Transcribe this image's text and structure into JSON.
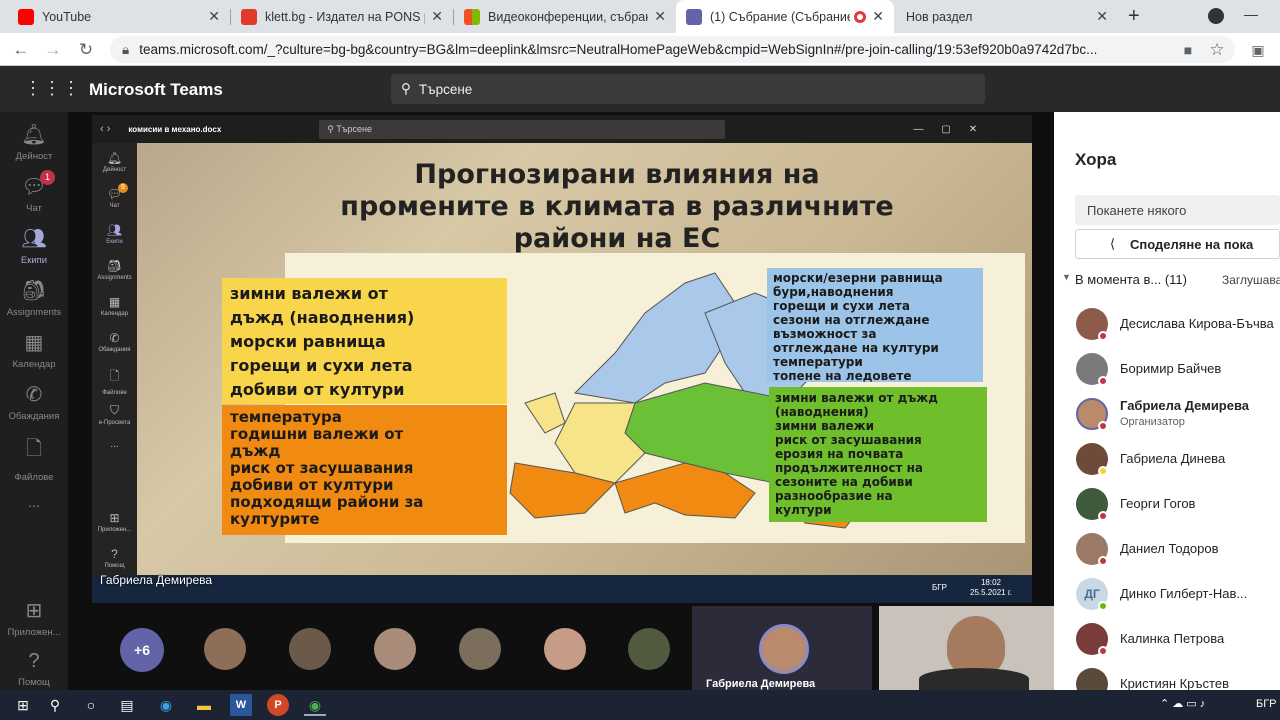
{
  "browser": {
    "tabs": [
      {
        "title": "YouTube",
        "color": "#ff0000"
      },
      {
        "title": "klett.bg - Издател на PONS p",
        "color": "#e23b2e"
      },
      {
        "title": "Видеоконференции, събран",
        "color": "#f25022"
      },
      {
        "title": "(1) Събрание (Събрание",
        "color": "#6264a7"
      },
      {
        "title": "Нов раздел",
        "color": ""
      }
    ],
    "url": "teams.microsoft.com/_?culture=bg-bg&country=BG&lm=deeplink&lmsrc=NeutralHomePageWeb&cmpid=WebSignIn#/pre-join-calling/19:53ef920b0a9742d7bc..."
  },
  "teams": {
    "app_title": "Microsoft Teams",
    "search_placeholder": "Търсене",
    "rail": [
      {
        "label": "Дейност",
        "icon": "bell-icon"
      },
      {
        "label": "Чат",
        "icon": "chat-icon",
        "badge": "1"
      },
      {
        "label": "Екипи",
        "icon": "teams-icon"
      },
      {
        "label": "Assignments",
        "icon": "assignments-icon"
      },
      {
        "label": "Календар",
        "icon": "calendar-icon"
      },
      {
        "label": "Обаждания",
        "icon": "phone-icon"
      },
      {
        "label": "Файлове",
        "icon": "file-icon"
      },
      {
        "label": "...",
        "icon": "more-icon"
      },
      {
        "label": "Приложен...",
        "icon": "apps-icon"
      },
      {
        "label": "Помощ",
        "icon": "help-icon"
      }
    ]
  },
  "shared": {
    "doc_title": "комисии в механо.docx",
    "search_placeholder": "Търсене",
    "inner_rail": [
      "Дейност",
      "Чат",
      "Екипи",
      "Assignments",
      "Календар",
      "Обаждания",
      "Файлове",
      "е-Просвета",
      "...",
      "Приложен...",
      "Помощ"
    ],
    "inner_chat_badge": "9",
    "presenter": "Габриела Демирева",
    "clock_time": "18:02",
    "clock_date": "25.5.2021 г.",
    "lang": "БГР"
  },
  "slide": {
    "title_line1": "Прогнозирани влияния на",
    "title_line2": "промените в климата в различните",
    "title_line3": "райони на ЕС",
    "yellow_box": [
      "зимни валежи от",
      "дъжд (наводнения)",
      "морски равнища",
      "горещи и сухи лета",
      "добиви от култури"
    ],
    "orange_box": [
      "температура",
      "годишни валежи от",
      "дъжд",
      "риск от засушавания",
      "добиви от култури",
      "подходящи райони за",
      "културите"
    ],
    "blue_box": [
      "морски/езерни равнища",
      "бури,наводнения",
      "горещи и сухи лета",
      "сезони на отглеждане",
      "възможност за",
      "отглеждане на култури",
      "температури",
      "топене на ледовете"
    ],
    "green_box": [
      "зимни валежи от дъжд",
      "(наводнения)",
      "зимни валежи",
      "риск от засушавания",
      "ерозия на почвата",
      "продължителност на",
      "сезоните на добиви",
      "разнообразие на",
      "култури"
    ]
  },
  "gallery": {
    "more_count": "+6",
    "active_name": "Габриела Демирева"
  },
  "people": {
    "title": "Хора",
    "invite_placeholder": "Поканете някого",
    "share_label": "Споделяне на пока",
    "section_label": "В момента в...",
    "section_count": "(11)",
    "mute_label": "Заглушава",
    "list": [
      {
        "name": "Десислава Кирова-Бъчва",
        "status_color": "#c4314b",
        "avatar_color": "#8e5b4a"
      },
      {
        "name": "Боримир Байчев",
        "status_color": "#c4314b",
        "avatar_color": "#7a7a7a"
      },
      {
        "name": "Габриела Демирева",
        "role": "Организатор",
        "status_color": "#c4314b",
        "avatar_color": "#b98a6b"
      },
      {
        "name": "Габриела Динева",
        "status_color": "#f8d22a",
        "avatar_color": "#6e4a3a"
      },
      {
        "name": "Георги Гогов",
        "status_color": "#c4314b",
        "avatar_color": "#3f5a3c"
      },
      {
        "name": "Даниел Тодоров",
        "status_color": "#c4314b",
        "avatar_color": "#9a7a66"
      },
      {
        "name": "Динко Гилберт-Нав...",
        "initials": "ДГ",
        "status_color": "#6bb700",
        "avatar_color": "#c7d8e6"
      },
      {
        "name": "Калинка Петрова",
        "status_color": "#c4314b",
        "avatar_color": "#7a3b3b"
      },
      {
        "name": "Кристиян Кръстев",
        "status_color": "#6bb700",
        "avatar_color": "#5a4a3a"
      }
    ]
  },
  "taskbar": {
    "lang": "БГР"
  }
}
